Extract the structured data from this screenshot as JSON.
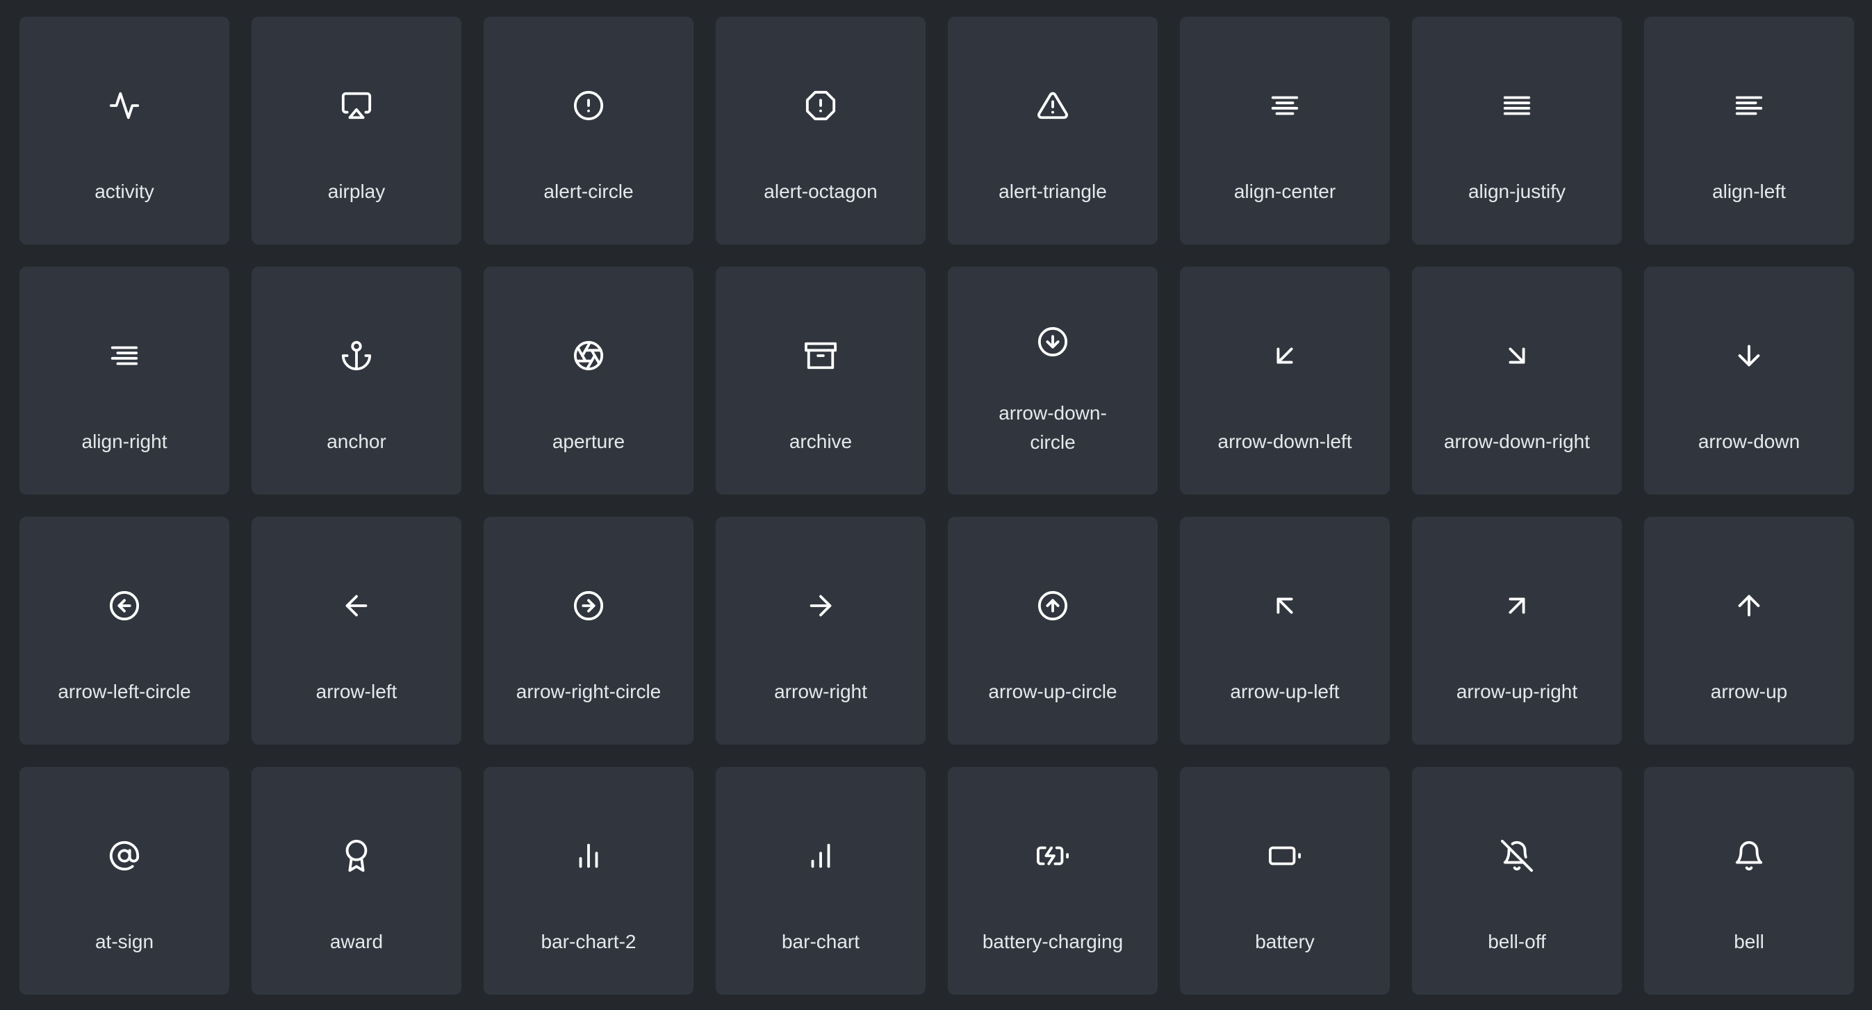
{
  "colors": {
    "background": "#24282d",
    "tile": "#31363e",
    "icon": "#ffffff",
    "label": "#e6e8eb"
  },
  "icons": [
    {
      "label": "activity",
      "icon": "activity-icon"
    },
    {
      "label": "airplay",
      "icon": "airplay-icon"
    },
    {
      "label": "alert-circle",
      "icon": "alert-circle-icon"
    },
    {
      "label": "alert-octagon",
      "icon": "alert-octagon-icon"
    },
    {
      "label": "alert-triangle",
      "icon": "alert-triangle-icon"
    },
    {
      "label": "align-center",
      "icon": "align-center-icon"
    },
    {
      "label": "align-justify",
      "icon": "align-justify-icon"
    },
    {
      "label": "align-left",
      "icon": "align-left-icon"
    },
    {
      "label": "align-right",
      "icon": "align-right-icon"
    },
    {
      "label": "anchor",
      "icon": "anchor-icon"
    },
    {
      "label": "aperture",
      "icon": "aperture-icon"
    },
    {
      "label": "archive",
      "icon": "archive-icon"
    },
    {
      "label": "arrow-down-circle",
      "icon": "arrow-down-circle-icon"
    },
    {
      "label": "arrow-down-left",
      "icon": "arrow-down-left-icon"
    },
    {
      "label": "arrow-down-right",
      "icon": "arrow-down-right-icon"
    },
    {
      "label": "arrow-down",
      "icon": "arrow-down-icon"
    },
    {
      "label": "arrow-left-circle",
      "icon": "arrow-left-circle-icon"
    },
    {
      "label": "arrow-left",
      "icon": "arrow-left-icon"
    },
    {
      "label": "arrow-right-circle",
      "icon": "arrow-right-circle-icon"
    },
    {
      "label": "arrow-right",
      "icon": "arrow-right-icon"
    },
    {
      "label": "arrow-up-circle",
      "icon": "arrow-up-circle-icon"
    },
    {
      "label": "arrow-up-left",
      "icon": "arrow-up-left-icon"
    },
    {
      "label": "arrow-up-right",
      "icon": "arrow-up-right-icon"
    },
    {
      "label": "arrow-up",
      "icon": "arrow-up-icon"
    },
    {
      "label": "at-sign",
      "icon": "at-sign-icon"
    },
    {
      "label": "award",
      "icon": "award-icon"
    },
    {
      "label": "bar-chart-2",
      "icon": "bar-chart-2-icon"
    },
    {
      "label": "bar-chart",
      "icon": "bar-chart-icon"
    },
    {
      "label": "battery-charging",
      "icon": "battery-charging-icon"
    },
    {
      "label": "battery",
      "icon": "battery-icon"
    },
    {
      "label": "bell-off",
      "icon": "bell-off-icon"
    },
    {
      "label": "bell",
      "icon": "bell-icon"
    }
  ]
}
